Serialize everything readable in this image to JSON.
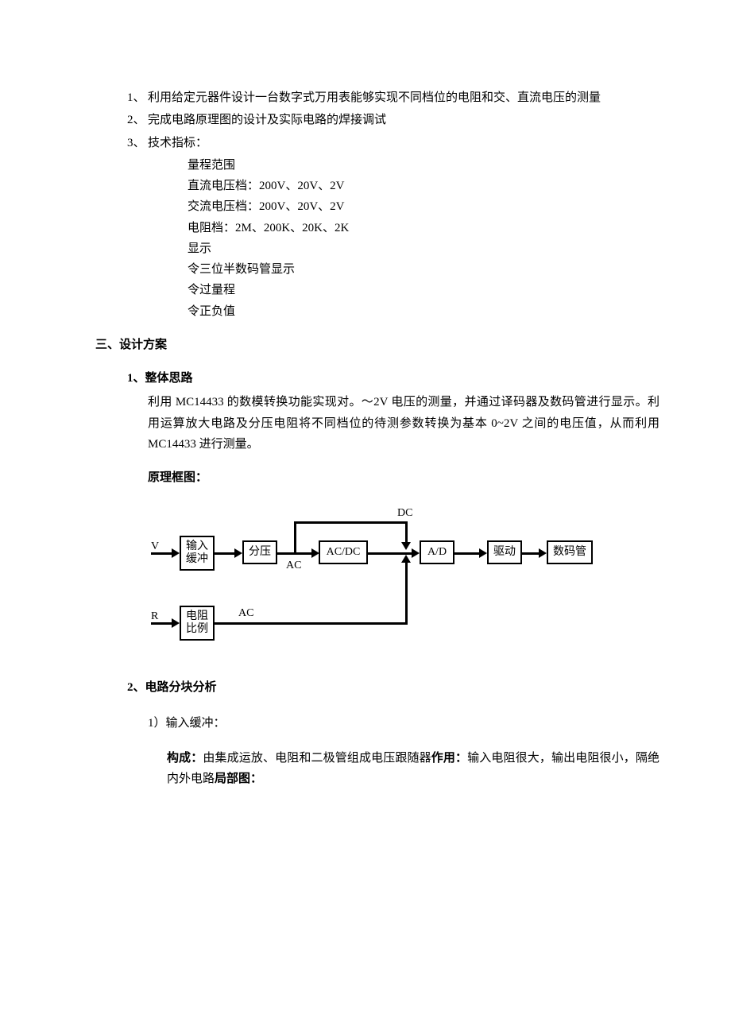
{
  "requirements": {
    "item1": {
      "marker": "1、",
      "text": "利用给定元器件设计一台数字式万用表能够实现不同档位的电阻和交、直流电压的测量"
    },
    "item2": {
      "marker": "2、",
      "text": "完成电路原理图的设计及实际电路的焊接调试"
    },
    "item3": {
      "marker": "3、",
      "text": "技术指标："
    },
    "specs": {
      "range_label": "量程范围",
      "dc": "直流电压档：200V、20V、2V",
      "ac": "交流电压档：200V、20V、2V",
      "res": "电阻档：2M、200K、20K、2K",
      "disp_label": "显示",
      "disp1": "令三位半数码管显示",
      "disp2": "令过量程",
      "disp3": "令正负值"
    }
  },
  "section3": {
    "title": "三、设计方案",
    "sub1": {
      "title": "1、整体思路",
      "text": "利用 MC14433 的数模转换功能实现对。～2V 电压的测量，并通过译码器及数码管进行显示。利用运算放大电路及分压电阻将不同档位的待测参数转换为基本 0~2V 之间的电压值，从而利用 MC14433 进行测量。",
      "diagram_title": "原理框图："
    },
    "sub2": {
      "title": "2、电路分块分析",
      "p1": {
        "marker": "1）输入缓冲：",
        "comp_label": "构成：",
        "comp_text": "由集成运放、电阻和二极管组成电压跟随器",
        "func_label": "作用：",
        "func_text": "输入电阻很大，输出电阻很小，隔绝内外电路",
        "local_label": "局部图："
      }
    }
  },
  "diagram": {
    "V": "V",
    "R": "R",
    "DC": "DC",
    "AC1": "AC",
    "AC2": "AC",
    "box1": "输入\n缓冲",
    "box2": "分压",
    "box3": "AC/DC",
    "box4": "A/D",
    "box5": "驱动",
    "box6": "数码管",
    "box7": "电阻\n比例"
  }
}
